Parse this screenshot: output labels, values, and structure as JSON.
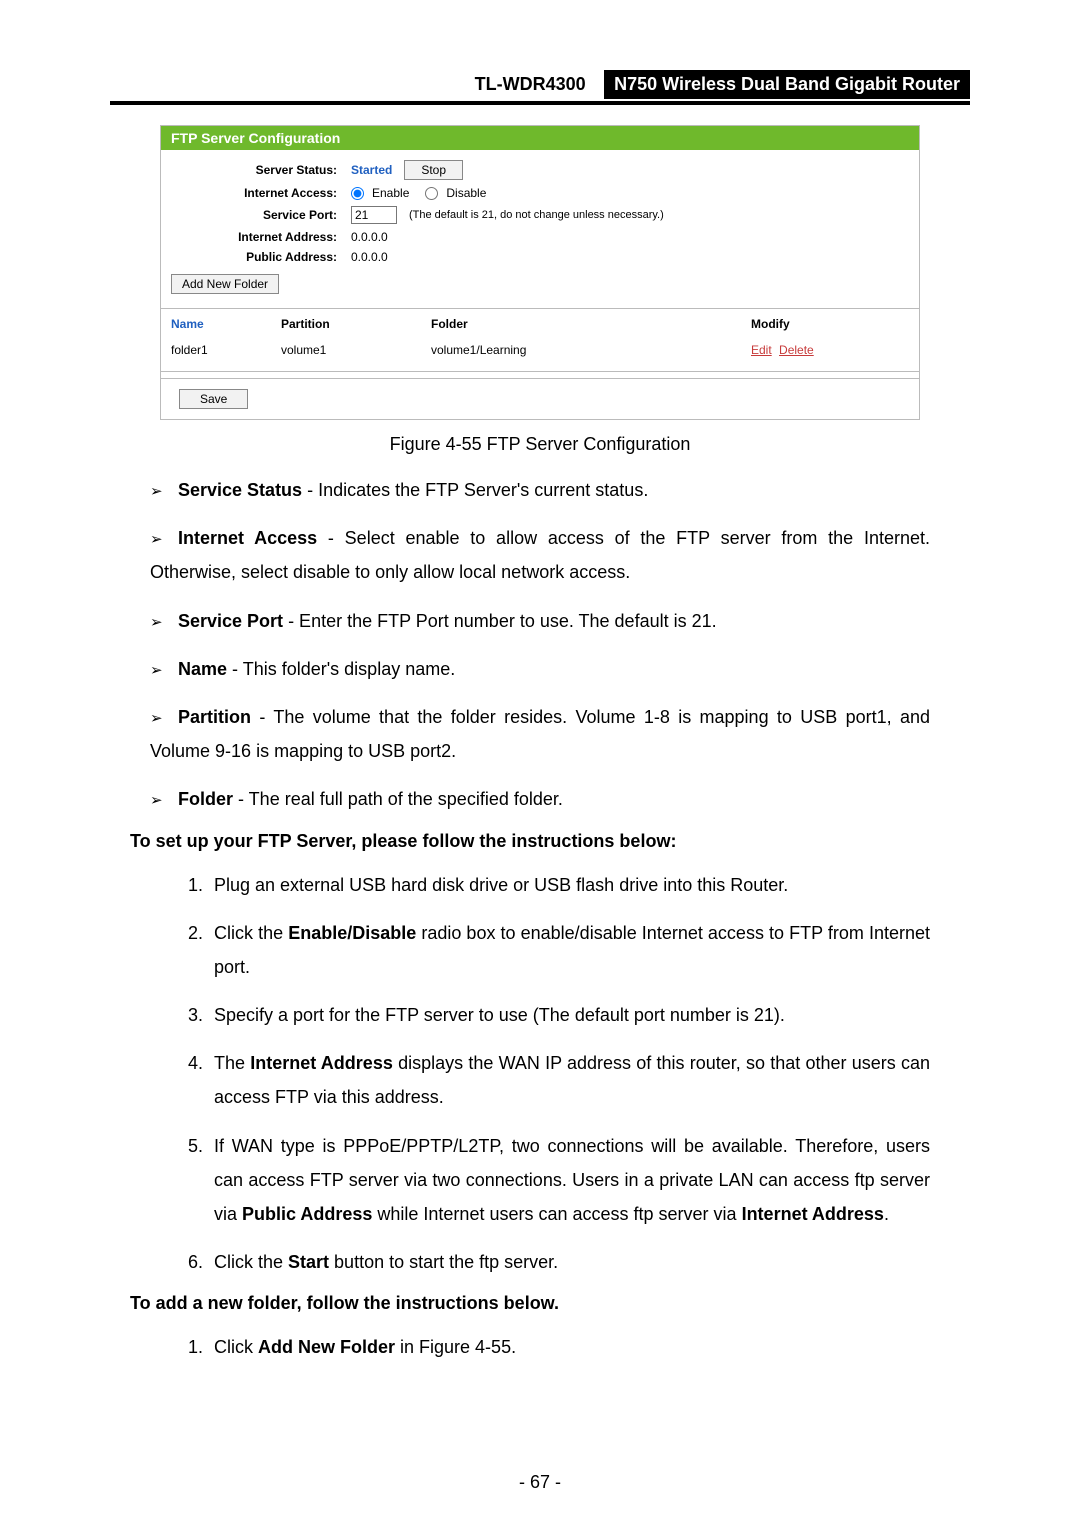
{
  "header": {
    "model": "TL-WDR4300",
    "product": "N750 Wireless Dual Band Gigabit Router"
  },
  "panel": {
    "title": "FTP Server Configuration",
    "labels": {
      "server_status": "Server Status:",
      "internet_access": "Internet Access:",
      "service_port": "Service Port:",
      "internet_address": "Internet Address:",
      "public_address": "Public Address:"
    },
    "values": {
      "status_text": "Started",
      "stop_button": "Stop",
      "enable_label": "Enable",
      "disable_label": "Disable",
      "port_value": "21",
      "port_note": "(The default is 21, do not change unless necessary.)",
      "internet_addr": "0.0.0.0",
      "public_addr": "0.0.0.0"
    },
    "add_folder_button": "Add New Folder",
    "columns": {
      "name": "Name",
      "partition": "Partition",
      "folder": "Folder",
      "modify": "Modify"
    },
    "rows": [
      {
        "name": "folder1",
        "partition": "volume1",
        "folder": "volume1/Learning",
        "edit": "Edit",
        "delete": "Delete"
      }
    ],
    "save_button": "Save"
  },
  "caption": "Figure 4-55 FTP Server Configuration",
  "bullets": [
    {
      "term": "Service Status",
      "text": " - Indicates the FTP Server's current status."
    },
    {
      "term": "Internet Access",
      "text": " - Select enable to allow access of the FTP server from the Internet. Otherwise, select disable to only allow local network access."
    },
    {
      "term": "Service Port",
      "text": " - Enter the FTP Port number to use. The default is 21."
    },
    {
      "term": "Name",
      "text": " - This folder's display name."
    },
    {
      "term": "Partition",
      "text": " - The volume that the folder resides. Volume 1-8 is mapping to USB port1, and Volume 9-16 is mapping to USB port2."
    },
    {
      "term": "Folder",
      "text": " - The real full path of the specified folder."
    }
  ],
  "section1_head": "To set up your FTP Server, please follow the instructions below:",
  "steps1": [
    "Plug an external USB hard disk drive or USB flash drive into this Router.",
    "Click the <b>Enable/Disable</b> radio box to enable/disable Internet access to FTP from Internet port.",
    "Specify a port for the FTP server to use (The default port number is 21).",
    "The <b>Internet Address</b> displays the WAN IP address of this router, so that other users can access FTP via this address.",
    "If WAN type is PPPoE/PPTP/L2TP, two connections will be available. Therefore, users can access FTP server via two connections. Users in a private LAN can access ftp server via <b>Public Address</b> while Internet users can access ftp server via <b>Internet Address</b>.",
    "Click the <b>Start</b> button to start the ftp server."
  ],
  "section2_head": "To add a new folder, follow the instructions below.",
  "steps2": [
    "Click <b>Add New Folder</b> in Figure 4-55."
  ],
  "page_number": "- 67 -"
}
